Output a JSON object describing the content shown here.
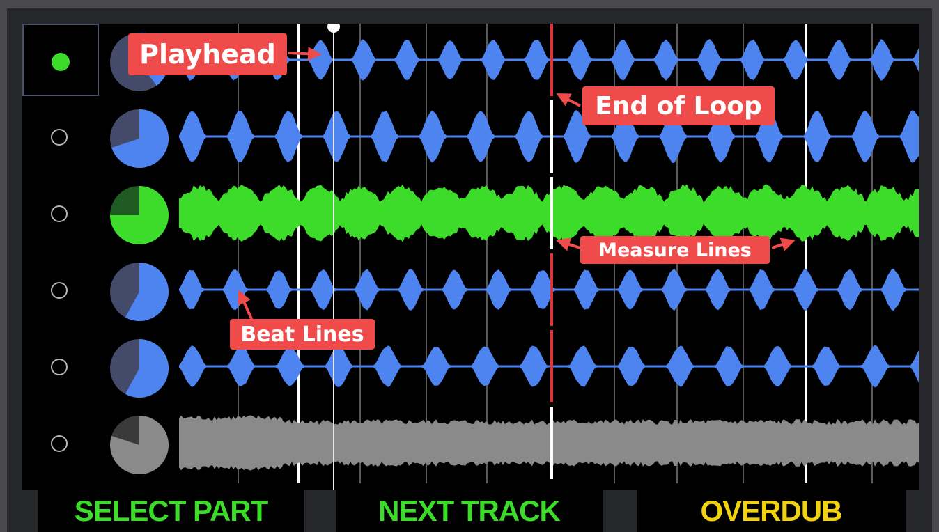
{
  "colors": {
    "accent_green": "#3ddc2a",
    "wave_blue": "#4d84f0",
    "wave_gray": "#8a8a8a",
    "loop_end_red": "#e0333a",
    "callout_bg": "#ef4b4b",
    "softkey_green": "#3ddc2a",
    "softkey_yellow": "#f1d20f"
  },
  "tracks": [
    {
      "selected": true,
      "color": "blue",
      "progress": 0.4
    },
    {
      "selected": false,
      "color": "blue",
      "progress": 0.7
    },
    {
      "selected": false,
      "color": "green",
      "progress": 0.75
    },
    {
      "selected": false,
      "color": "blue",
      "progress": 0.58
    },
    {
      "selected": false,
      "color": "blue",
      "progress": 0.58
    },
    {
      "selected": false,
      "color": "gray",
      "progress": 0.8
    }
  ],
  "annotations": {
    "playhead": "Playhead",
    "end_of_loop": "End of Loop",
    "measure_lines": "Measure Lines",
    "beat_lines": "Beat Lines"
  },
  "soft_keys": [
    {
      "label": "SELECT PART",
      "color": "#3ddc2a"
    },
    {
      "label": "NEXT TRACK",
      "color": "#3ddc2a"
    },
    {
      "label": "OVERDUB",
      "color": "#f1d20f"
    }
  ]
}
